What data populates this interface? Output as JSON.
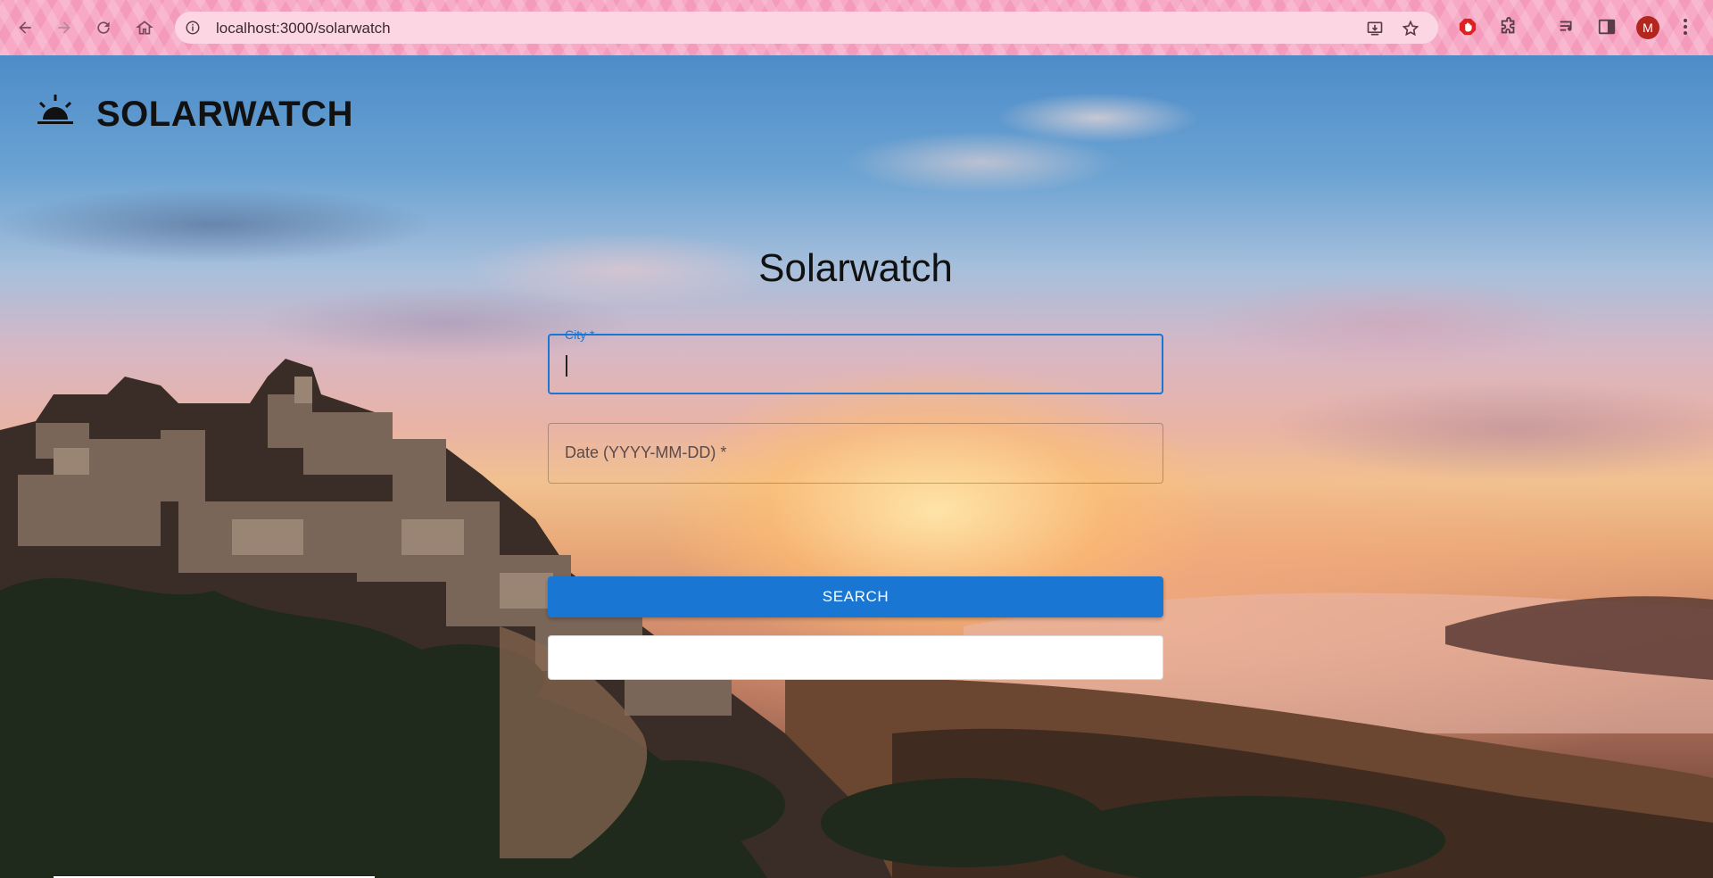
{
  "browser": {
    "url": "localhost:3000/solarwatch",
    "profile_initial": "M",
    "icons": {
      "back": "back-arrow-icon",
      "forward": "forward-arrow-icon",
      "reload": "reload-icon",
      "home": "home-icon",
      "site_info": "site-info-icon",
      "install": "install-app-icon",
      "bookmark": "star-icon",
      "extension_red": "adblock-icon",
      "extensions": "puzzle-icon",
      "media": "media-controls-icon",
      "side_panel": "side-panel-icon",
      "menu": "kebab-menu-icon"
    },
    "colors": {
      "chrome": "#f7a9c6",
      "omnibox": "#fcd6e3",
      "avatar": "#b3261e"
    }
  },
  "app": {
    "brand": "SOLARWATCH",
    "brand_icon": "sunset-icon"
  },
  "form": {
    "title": "Solarwatch",
    "city_label": "City *",
    "city_value": "",
    "date_placeholder": "Date (YYYY-MM-DD) *",
    "search_label": "SEARCH",
    "result_text": "",
    "accent": "#1976d2"
  }
}
